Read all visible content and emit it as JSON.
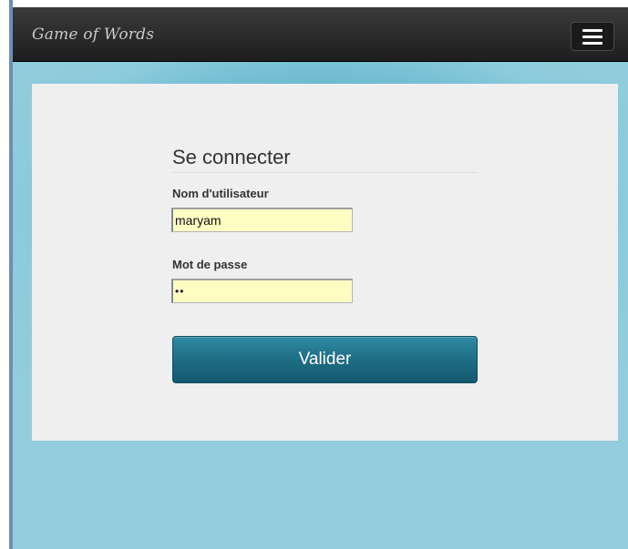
{
  "app": {
    "brand": "Game of Words"
  },
  "navbar": {
    "menu_icon": "hamburger-menu-icon"
  },
  "login": {
    "title": "Se connecter",
    "username_label": "Nom d'utilisateur",
    "username_value": "maryam",
    "password_label": "Mot de passe",
    "password_value": "••",
    "submit_label": "Valider"
  },
  "colors": {
    "navbar": "#262626",
    "background": "#93cddd",
    "panel": "#efefef",
    "input_autofill": "#fdfdc3",
    "button": "#1d6b82"
  }
}
